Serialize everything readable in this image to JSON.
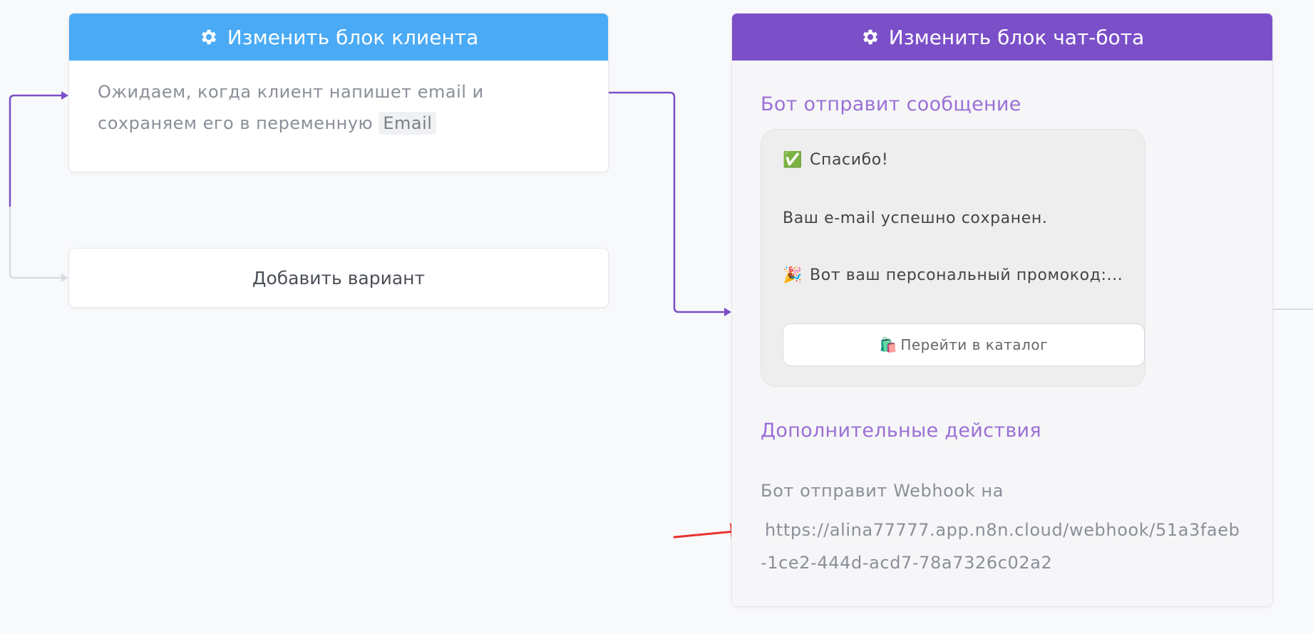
{
  "client_block": {
    "header": "Изменить блок клиента",
    "body_text": "Ожидаем, когда клиент напишет email и сохраняем его в переменную",
    "variable": "Email"
  },
  "add_variant": {
    "label": "Добавить вариант"
  },
  "bot_block": {
    "header": "Изменить блок чат-бота",
    "message_section_title": "Бот отправит сообщение",
    "message": {
      "line1_emoji": "✅",
      "line1": "Спасибо!",
      "line2": "Ваш e-mail успешно сохранен.",
      "line3_emoji": "🎉",
      "line3": "Вот ваш персональный промокод:...",
      "button_emoji": "🛍️",
      "button_label": "Перейти в каталог"
    },
    "actions_section_title": "Дополнительные действия",
    "webhook_label": "Бот отправит Webhook на",
    "webhook_url": "https://alina77777.app.n8n.cloud/webhook/51a3faeb-1ce2-444d-acd7-78a7326c02a2"
  },
  "colors": {
    "client_header": "#4aaaf5",
    "bot_header": "#7b4fc8",
    "connector": "#7b4fc8",
    "annotation_arrow": "#e8322e"
  },
  "icons": [
    "gear-icon",
    "arrow-right-icon",
    "annotation-arrow-icon"
  ]
}
